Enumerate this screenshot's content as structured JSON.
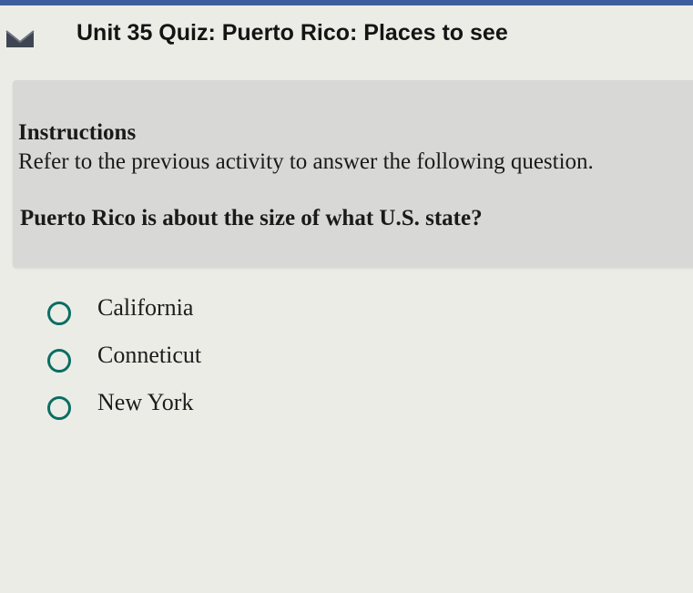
{
  "header": {
    "title": "Unit 35 Quiz: Puerto Rico: Places to see",
    "icon": "menu-toggle-icon"
  },
  "instructions": {
    "heading": "Instructions",
    "body": "Refer to the previous activity to answer the following question."
  },
  "question": {
    "text": "Puerto Rico is about the size of what U.S. state?",
    "options": [
      {
        "label": "California"
      },
      {
        "label": "Conneticut"
      },
      {
        "label": "New York"
      }
    ]
  },
  "colors": {
    "accent": "#0a6e63",
    "top_strip": "#3b5d9c",
    "panel": "#d8d9d6",
    "background": "#ecece6"
  }
}
